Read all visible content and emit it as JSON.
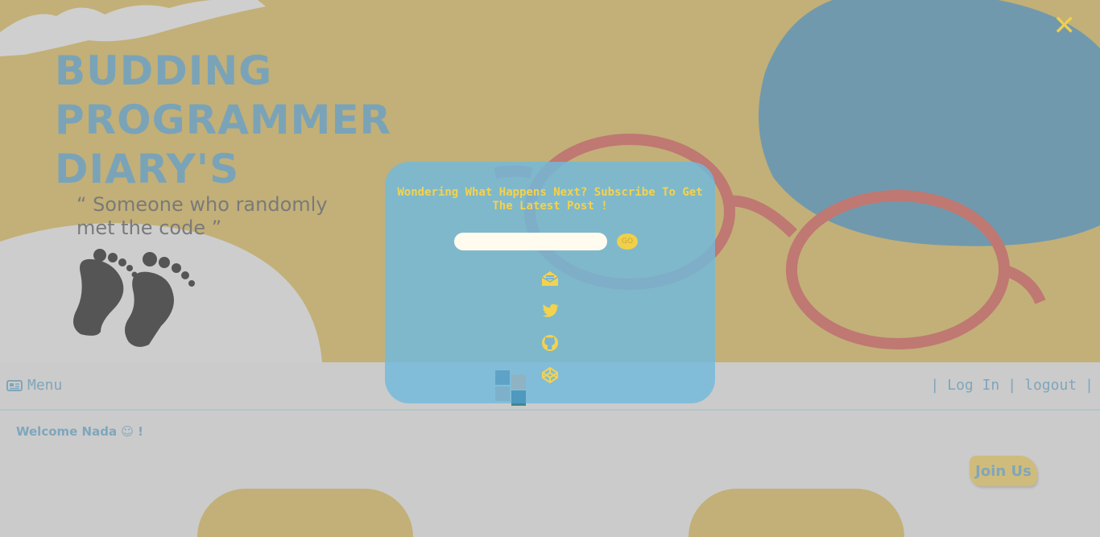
{
  "header": {
    "title_line1": "BUDDING",
    "title_line2": "PROGRAMMER",
    "title_line3": "DIARY'S",
    "tagline": "“ Someone who randomly met the code ”",
    "close_symbol": "✕"
  },
  "nav": {
    "menu_label": "Menu",
    "menu_icon": "newspaper-icon",
    "separator": "|",
    "login_label": "Log In",
    "logout_label": "logout"
  },
  "welcome": {
    "text": "Welcome Nada ☺ !"
  },
  "join_button": {
    "label": "Join Us"
  },
  "popup": {
    "heading": "Wondering What Happens Next? Subscribe To Get The Latest Post !",
    "email_placeholder": "",
    "go_label": "GO",
    "social_icons": [
      "envelope-open-icon",
      "twitter-icon",
      "github-icon",
      "codepen-icon"
    ]
  },
  "colors": {
    "hero_bg": "#c2b078",
    "accent_blue": "#7aa3b8",
    "accent_yellow": "#f5d24c",
    "glasses_red": "#bf7872",
    "page_bg": "#cbcbcb"
  }
}
